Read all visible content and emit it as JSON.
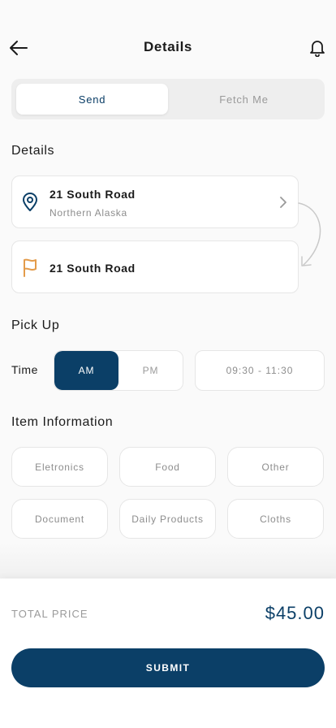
{
  "header": {
    "title": "Details",
    "back_icon": "arrow-left-icon",
    "notification_icon": "bell-icon"
  },
  "tabs": [
    {
      "label": "Send",
      "active": true
    },
    {
      "label": "Fetch Me",
      "active": false
    }
  ],
  "details": {
    "label": "Details",
    "origin": {
      "title": "21 South Road",
      "subtitle": "Northern Alaska",
      "icon": "location-pin-icon"
    },
    "destination": {
      "title": "21 South Road",
      "icon": "flag-icon"
    }
  },
  "pickup": {
    "label": "Pick Up",
    "time_label": "Time",
    "am_label": "AM",
    "pm_label": "PM",
    "selected": "AM",
    "time_range": "09:30 - 11:30"
  },
  "items": {
    "label": "Item Information",
    "options": [
      "Eletronics",
      "Food",
      "Other",
      "Document",
      "Daily Products",
      "Cloths"
    ]
  },
  "total": {
    "label": "TOTAL PRICE",
    "value": "$45.00"
  },
  "submit_label": "SUBMIT",
  "colors": {
    "primary": "#0b3f67",
    "flag_accent": "#e39b4a",
    "background": "#fafafa"
  }
}
